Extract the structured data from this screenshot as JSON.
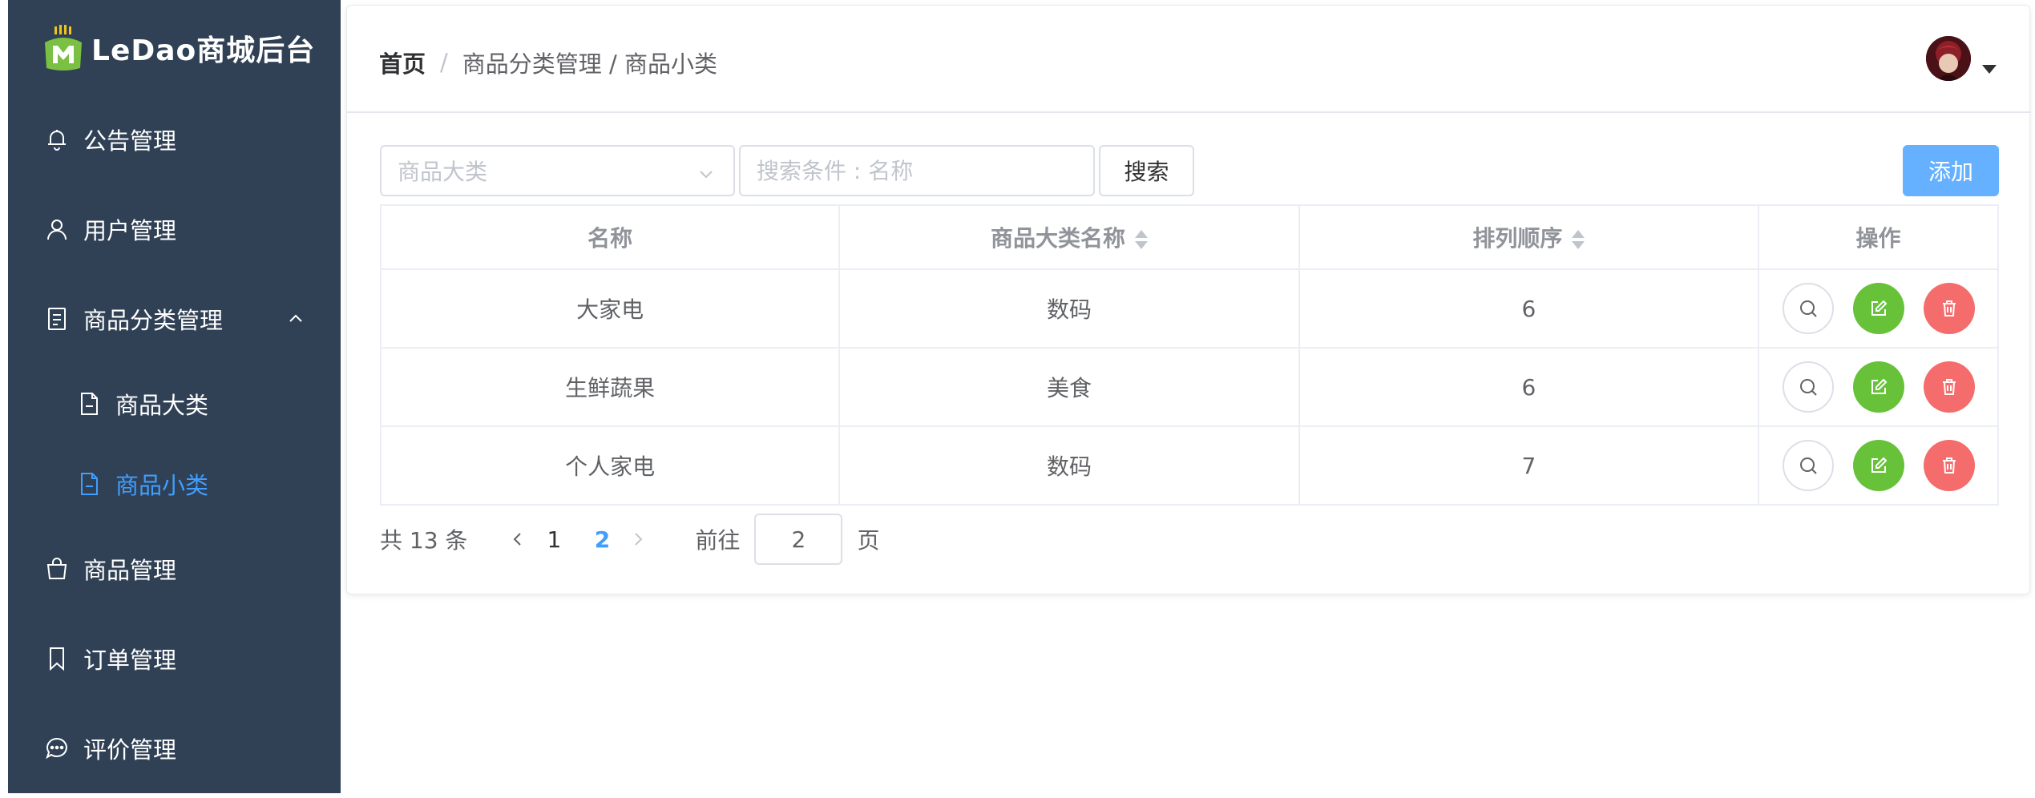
{
  "app": {
    "logo_text": "LeDao商城后台"
  },
  "sidebar": {
    "items": [
      {
        "label": "公告管理",
        "icon": "bell-icon"
      },
      {
        "label": "用户管理",
        "icon": "user-icon"
      },
      {
        "label": "商品分类管理",
        "icon": "document-icon",
        "expanded": true
      },
      {
        "label": "商品大类",
        "icon": "file-icon"
      },
      {
        "label": "商品小类",
        "icon": "file-icon",
        "active": true
      },
      {
        "label": "商品管理",
        "icon": "shopping-bag-icon"
      },
      {
        "label": "订单管理",
        "icon": "bookmark-icon"
      },
      {
        "label": "评价管理",
        "icon": "chat-icon"
      }
    ]
  },
  "breadcrumb": {
    "home": "首页",
    "sep": "/",
    "path": "商品分类管理 / 商品小类"
  },
  "search": {
    "category_placeholder": "商品大类",
    "keyword_placeholder": "搜索条件 : 名称",
    "search_label": "搜索",
    "add_label": "添加"
  },
  "table": {
    "columns": [
      "名称",
      "商品大类名称",
      "排列顺序",
      "操作"
    ],
    "rows": [
      {
        "name": "大家电",
        "category": "数码",
        "order": "6"
      },
      {
        "name": "生鲜蔬果",
        "category": "美食",
        "order": "6"
      },
      {
        "name": "个人家电",
        "category": "数码",
        "order": "7"
      }
    ]
  },
  "pagination": {
    "total_text": "共 13 条",
    "pages": [
      "1",
      "2"
    ],
    "current_page": "2",
    "goto_label": "前往",
    "goto_value": "2",
    "page_suffix": "页"
  },
  "colors": {
    "sidebar_bg": "#304156",
    "accent": "#409eff",
    "add_button": "#66b1ff",
    "edit_button": "#67c23a",
    "delete_button": "#f56c6c"
  }
}
